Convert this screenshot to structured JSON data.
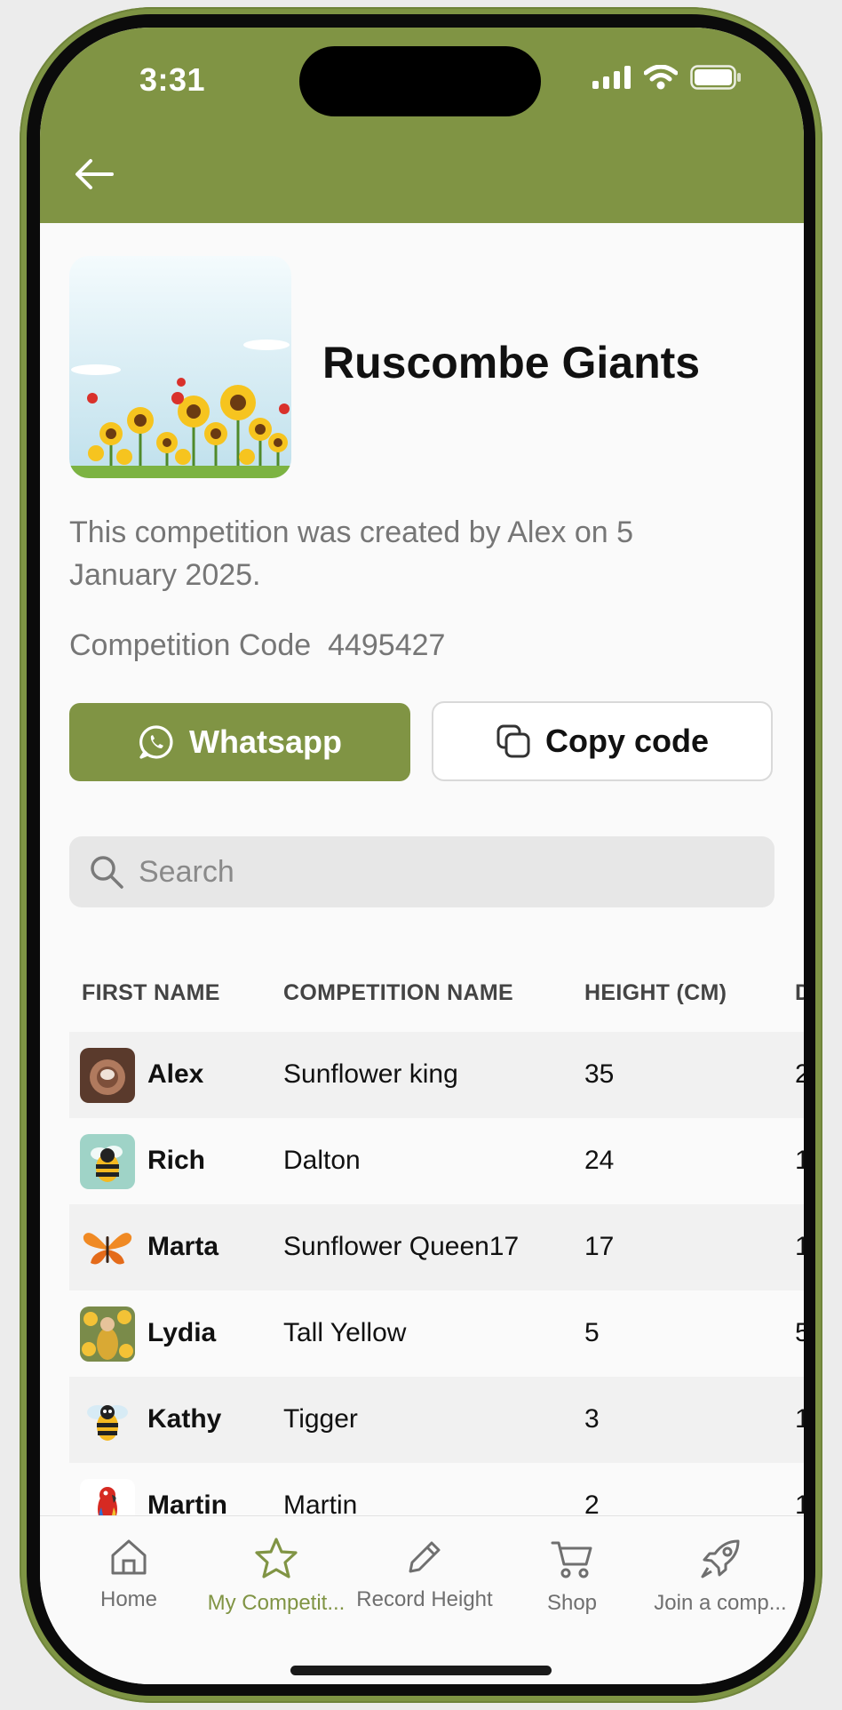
{
  "status_bar": {
    "time": "3:31"
  },
  "competition": {
    "title": "Ruscombe Giants",
    "created_text": "This competition was created by Alex on 5 January 2025.",
    "code_label": "Competition Code",
    "code_value": "4495427"
  },
  "actions": {
    "whatsapp_label": "Whatsapp",
    "copy_label": "Copy code"
  },
  "search": {
    "placeholder": "Search"
  },
  "table": {
    "columns": [
      "FIRST NAME",
      "COMPETITION NAME",
      "HEIGHT (CM)",
      "D"
    ],
    "rows": [
      {
        "first_name": "Alex",
        "competition_name": "Sunflower king",
        "height": "35",
        "extra": "2",
        "avatar": "photo-avatar"
      },
      {
        "first_name": "Rich",
        "competition_name": "Dalton",
        "height": "24",
        "extra": "1",
        "avatar": "bee-avatar"
      },
      {
        "first_name": "Marta",
        "competition_name": "Sunflower Queen17",
        "height": "17",
        "extra": "1",
        "avatar": "butterfly-avatar"
      },
      {
        "first_name": "Lydia",
        "competition_name": "Tall Yellow",
        "height": "5",
        "extra": "5",
        "avatar": "sunflower-figure-avatar"
      },
      {
        "first_name": "Kathy",
        "competition_name": "Tigger",
        "height": "3",
        "extra": "1",
        "avatar": "bee-avatar"
      },
      {
        "first_name": "Martin",
        "competition_name": "Martin",
        "height": "2",
        "extra": "1",
        "avatar": "parrot-avatar"
      }
    ]
  },
  "nav": {
    "items": [
      {
        "label": "Home",
        "icon": "home-icon"
      },
      {
        "label": "My Competit...",
        "icon": "star-icon"
      },
      {
        "label": "Record Height",
        "icon": "pencil-icon"
      },
      {
        "label": "Shop",
        "icon": "cart-icon"
      },
      {
        "label": "Join a comp...",
        "icon": "rocket-icon"
      }
    ],
    "active_index": 1
  },
  "colors": {
    "brand": "#809444",
    "frame": "#7e9444"
  }
}
